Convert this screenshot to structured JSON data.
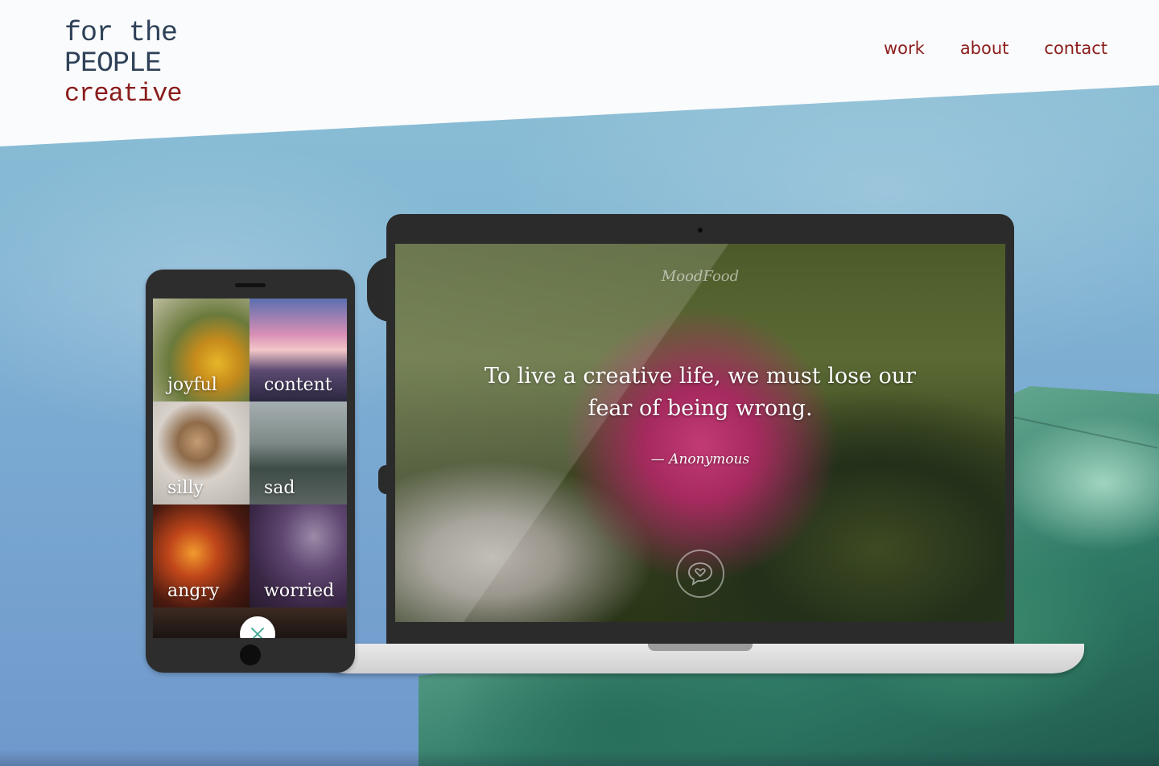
{
  "logo": {
    "line1": "for the",
    "line2": "PEOPLE",
    "line3": "creative"
  },
  "nav": {
    "items": [
      "work",
      "about",
      "contact"
    ]
  },
  "phone_app": {
    "moods": [
      "joyful",
      "content",
      "silly",
      "sad",
      "angry",
      "worried"
    ],
    "close_icon": "close-icon"
  },
  "laptop_app": {
    "brand": "MoodFood",
    "quote": "To live a creative life, we must lose our fear of being wrong.",
    "author": "— Anonymous",
    "heart_icon": "heart-chat-icon"
  },
  "colors": {
    "nav": "#8c1d1d",
    "logo_dark": "#2e4158",
    "logo_accent": "#8a1c1c"
  }
}
